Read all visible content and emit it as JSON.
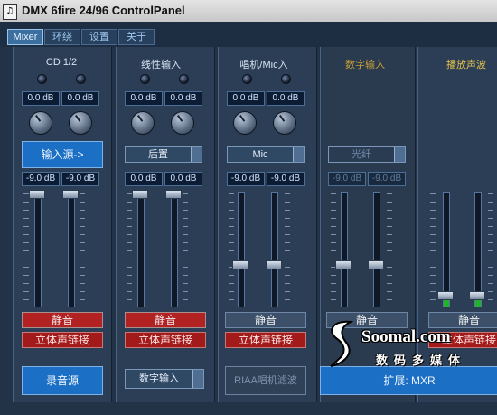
{
  "window": {
    "title": "DMX 6fire 24/96 ControlPanel"
  },
  "tabs": [
    "Mixer",
    "环绕",
    "设置",
    "关于"
  ],
  "channels": [
    {
      "name": "CD 1/2",
      "db_top": [
        "0.0 dB",
        "0.0 dB"
      ],
      "source_button": "输入源->",
      "db_fader": [
        "-9.0 dB",
        "-9.0 dB"
      ],
      "mute": "静音",
      "link": "立体声链接"
    },
    {
      "name": "线性输入",
      "db_top": [
        "0.0 dB",
        "0.0 dB"
      ],
      "combo": "后置",
      "db_fader": [
        "0.0 dB",
        "0.0 dB"
      ],
      "mute": "静音",
      "link": "立体声链接"
    },
    {
      "name": "唱机/Mic入",
      "db_top": [
        "0.0 dB",
        "0.0 dB"
      ],
      "combo": "Mic",
      "db_fader": [
        "-9.0 dB",
        "-9.0 dB"
      ],
      "mute": "静音",
      "link": "立体声链接"
    },
    {
      "name": "数字输入",
      "combo": "光纤",
      "db_fader": [
        "-9.0 dB",
        "-9.0 dB"
      ],
      "mute": "静音"
    },
    {
      "name": "播放声波",
      "mute": "静音",
      "link": "立体声链接"
    }
  ],
  "bottom": {
    "record_source": "录音源",
    "digital_input": "数字输入",
    "riaa": "RIAA唱机滤波",
    "expand": "扩展: MXR"
  },
  "watermark": {
    "brand": "Soomal.com",
    "sub": "数码多媒体"
  },
  "playback_level": 0.08,
  "colors": {
    "accent": "#1b6fc4",
    "mute_red": "#b32222",
    "background": "#223247"
  }
}
